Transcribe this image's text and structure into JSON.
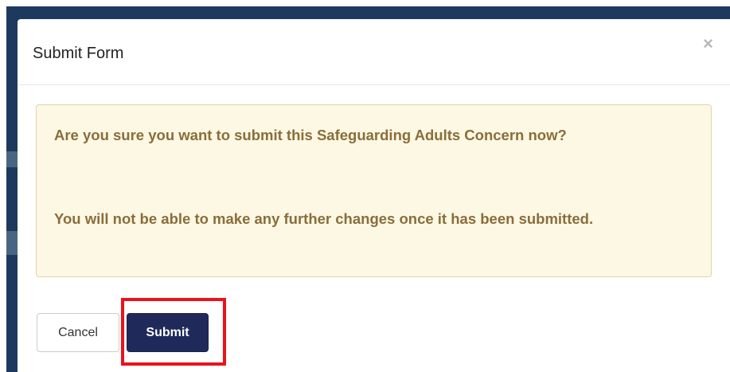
{
  "modal": {
    "title": "Submit Form",
    "close_glyph": "×",
    "alert": {
      "line1": "Are you sure you want to submit this Safeguarding Adults Concern now?",
      "line2": "You will not be able to make any further changes once it has been submitted."
    },
    "buttons": {
      "cancel_label": "Cancel",
      "submit_label": "Submit"
    }
  },
  "colors": {
    "backdrop": "#1d3a5e",
    "alert_background": "#fcf8e3",
    "alert_text": "#8a6d3b",
    "submit_background": "#1f2a5a",
    "highlight": "#e8141c"
  },
  "icons": {
    "close": "close-icon"
  }
}
